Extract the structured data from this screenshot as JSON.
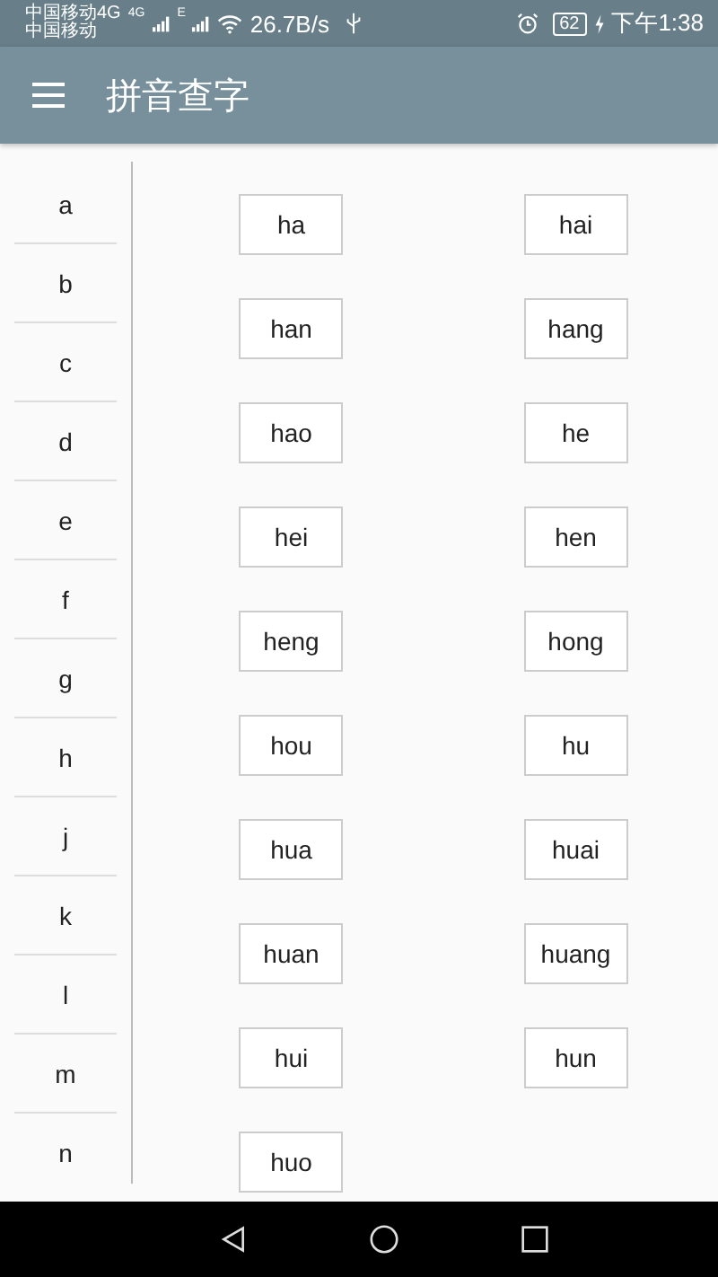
{
  "status_bar": {
    "carrier_1": "中国移动4G",
    "carrier_2": "中国移动",
    "network_1": "4G",
    "network_2": "E",
    "speed": "26.7B/s",
    "battery": "62",
    "time": "下午1:38"
  },
  "app_bar": {
    "title": "拼音查字"
  },
  "letters": [
    {
      "label": "a"
    },
    {
      "label": "b"
    },
    {
      "label": "c"
    },
    {
      "label": "d"
    },
    {
      "label": "e"
    },
    {
      "label": "f"
    },
    {
      "label": "g"
    },
    {
      "label": "h"
    },
    {
      "label": "j"
    },
    {
      "label": "k"
    },
    {
      "label": "l"
    },
    {
      "label": "m"
    },
    {
      "label": "n"
    }
  ],
  "syllables": [
    "ha",
    "hai",
    "han",
    "hang",
    "hao",
    "he",
    "hei",
    "hen",
    "heng",
    "hong",
    "hou",
    "hu",
    "hua",
    "huai",
    "huan",
    "huang",
    "hui",
    "hun",
    "huo"
  ]
}
